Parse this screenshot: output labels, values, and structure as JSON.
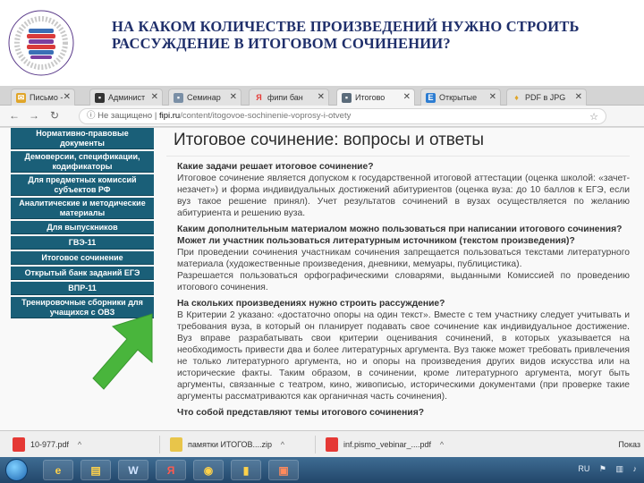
{
  "slide": {
    "title": "НА КАКОМ КОЛИЧЕСТВЕ ПРОИЗВЕДЕНИЙ НУЖНО СТРОИТЬ РАССУЖДЕНИЕ В ИТОГОВОМ СОЧИНЕНИИ?"
  },
  "browser": {
    "tabs": [
      {
        "label": "Письмо -",
        "icon": "mail-icon"
      },
      {
        "label": "Админист",
        "icon": "admin-icon"
      },
      {
        "label": "Семинар",
        "icon": "seminar-icon"
      },
      {
        "label": "фипи бан",
        "icon": "yandex-icon"
      },
      {
        "label": "Итогово",
        "icon": "doc-icon"
      },
      {
        "label": "Открытые",
        "icon": "open-bank-icon"
      },
      {
        "label": "PDF в JPG",
        "icon": "pdf-icon"
      }
    ],
    "address": {
      "warning": "Не защищено",
      "host": "fipi.ru",
      "path": "/content/itogovoe-sochinenie-voprosy-i-otvety"
    }
  },
  "sidebar": {
    "items": [
      "Нормативно-правовые документы",
      "Демоверсии, спецификации, кодификаторы",
      "Для предметных комиссий субъектов РФ",
      "Аналитические и методические материалы",
      "Для выпускников",
      "ГВЭ-11",
      "Итоговое сочинение",
      "Открытый банк заданий ЕГЭ",
      "ВПР-11",
      "Тренировочные сборники для учащихся с ОВЗ"
    ]
  },
  "content": {
    "heading": "Итоговое сочинение: вопросы и ответы",
    "qa": [
      {
        "q": "Какие задачи решает итоговое сочинение?",
        "a": "Итоговое сочинение является допуском к государственной итоговой аттестации (оценка школой: «зачет-незачет») и форма индивидуальных достижений абитуриентов (оценка вуза: до 10 баллов к ЕГЭ, если вуз такое решение принял). Учет результатов сочинений в вузах осуществляется по желанию абитуриента и решению вуза."
      },
      {
        "q": "Каким дополнительным материалом можно пользоваться при написании итогового сочинения? Может ли участник пользоваться литературным источником (текстом произведения)?",
        "a": "При проведении сочинения участникам сочинения запрещается пользоваться текстами литературного материала (художественные произведения, дневники, мемуары, публицистика).",
        "a2": "Разрешается пользоваться орфографическими словарями, выданными Комиссией по проведению итогового сочинения."
      },
      {
        "q": "На скольких произведениях нужно строить рассуждение?",
        "a": "В Критерии 2 указано: «достаточно опоры на один текст». Вместе с тем участнику следует учитывать и требования вуза, в который он планирует подавать свое сочинение как индивидуальное достижение. Вуз вправе разрабатывать свои критерии оценивания сочинений, в которых указывается на необходимость привести два и более литературных аргумента. Вуз также может требовать привлечения не только литературного аргумента, но и опоры на произведения других видов искусства или на исторические факты. Таким образом, в сочинении, кроме литературного аргумента, могут быть аргументы, связанные с театром, кино, живописью, историческими документами (при проверке такие аргументы рассматриваются как органичная часть сочинения)."
      },
      {
        "q": "Что собой представляют темы итогового сочинения?"
      }
    ]
  },
  "downloads": {
    "items": [
      {
        "name": "10-977.pdf",
        "icon": "pdf-icon"
      },
      {
        "name": "памятки ИТОГОВ....zip",
        "icon": "zip-icon"
      },
      {
        "name": "inf.pismo_vebinar_....pdf",
        "icon": "pdf-icon"
      }
    ],
    "show_all": "Показ"
  },
  "taskbar": {
    "lang": "RU"
  },
  "colors": {
    "sidebar_bg": "#1a5f78",
    "title_color": "#1f2f6b",
    "arrow_green": "#49b53c"
  }
}
